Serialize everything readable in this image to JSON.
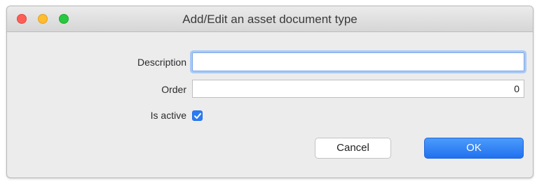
{
  "window": {
    "title": "Add/Edit an asset document type",
    "controls": {
      "close_color": "#fd5f57",
      "minimize_color": "#febc2e",
      "zoom_color": "#28c840"
    }
  },
  "form": {
    "description": {
      "label": "Description",
      "value": ""
    },
    "order": {
      "label": "Order",
      "value": "0"
    },
    "is_active": {
      "label": "Is active",
      "checked": true
    }
  },
  "buttons": {
    "cancel_label": "Cancel",
    "ok_label": "OK"
  },
  "colors": {
    "accent": "#2a7cf6",
    "focus_ring": "#a9c9f5"
  }
}
